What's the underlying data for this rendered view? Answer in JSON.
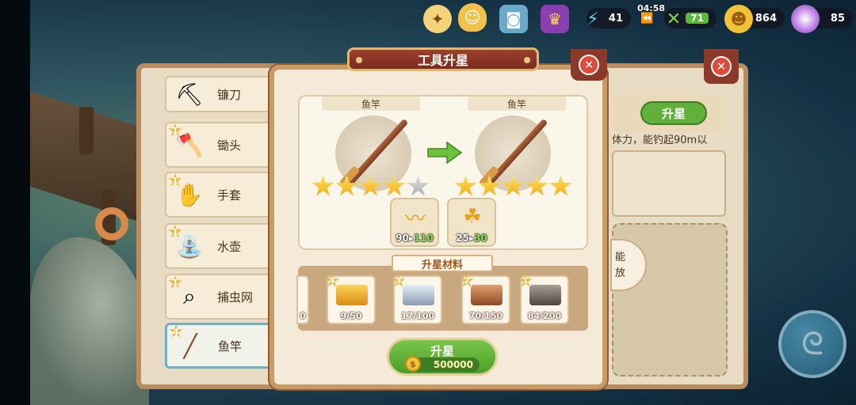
{
  "hud": {
    "energy": "41",
    "timer": "04:58",
    "stamina_level": "71",
    "gold": "864",
    "gems": "85"
  },
  "tool_list": [
    {
      "name": "镰刀",
      "level": "1",
      "icon": "sickle-icon"
    },
    {
      "name": "锄头",
      "level": "1",
      "icon": "hoe-icon"
    },
    {
      "name": "手套",
      "level": "1",
      "icon": "glove-icon"
    },
    {
      "name": "水壶",
      "level": "1",
      "icon": "watering-can-icon"
    },
    {
      "name": "捕虫网",
      "level": "1",
      "icon": "bug-net-icon"
    },
    {
      "name": "鱼竿",
      "level": "4",
      "icon": "fishing-rod-icon"
    }
  ],
  "right_panel": {
    "upstar_label": "升星",
    "description": "体力，能钓起90m以",
    "oval_line1": "能",
    "oval_line2": "放"
  },
  "modal": {
    "title": "工具升星",
    "current": {
      "label": "鱼竿",
      "stars_filled": 4,
      "stars_total": 5
    },
    "next": {
      "label": "鱼竿",
      "stars_filled": 5,
      "stars_total": 5
    },
    "attributes": [
      {
        "icon": "fishing-distance-icon",
        "from": "90",
        "to": "110"
      },
      {
        "icon": "luck-stamina-icon",
        "from": "25",
        "to": "30"
      }
    ],
    "materials_title": "升星材料",
    "partial_material_count": "0",
    "materials": [
      {
        "name": "gold-ingot",
        "star": "4",
        "count": "9/50",
        "color": "#f2b32c"
      },
      {
        "name": "silver-ingot",
        "star": "3",
        "count": "17/100",
        "color": "#b9c6d6"
      },
      {
        "name": "copper-ingot",
        "star": "2",
        "count": "70/150",
        "color": "#b8703f"
      },
      {
        "name": "iron-ingot",
        "star": "1",
        "count": "84/200",
        "color": "#6f655c"
      }
    ],
    "upstar_button": {
      "label": "升星",
      "cost": "500000"
    }
  }
}
